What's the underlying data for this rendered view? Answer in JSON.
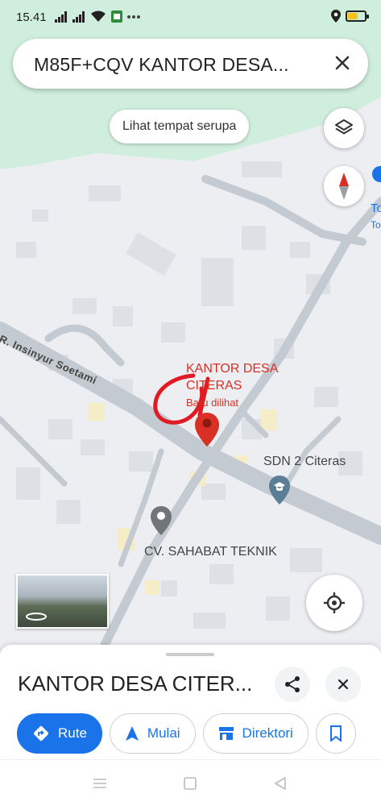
{
  "status_bar": {
    "time": "15.41"
  },
  "search": {
    "query": "M85F+CQV KANTOR DESA..."
  },
  "chips": {
    "similar_places": "Lihat tempat serupa"
  },
  "map": {
    "selected_place_name": "KANTOR DESA CITERAS",
    "selected_place_sub": "Baru dilihat",
    "poi_school": "SDN 2 Citeras",
    "poi_shop": "CV. SAHABAT TEKNIK",
    "road_label": "R. Insinyur Soetami",
    "edge_label_1": "To",
    "edge_label_2": "To",
    "colors": {
      "pin": "#d93025",
      "school": "#5b7e96",
      "poi_gray": "#70757a",
      "accent": "#1a73e8"
    }
  },
  "sheet": {
    "title": "KANTOR DESA CITER...",
    "buttons": [
      {
        "label": "Rute",
        "icon": "directions-icon"
      },
      {
        "label": "Mulai",
        "icon": "navigation-arrow-icon"
      },
      {
        "label": "Direktori",
        "icon": "storefront-icon"
      }
    ]
  }
}
